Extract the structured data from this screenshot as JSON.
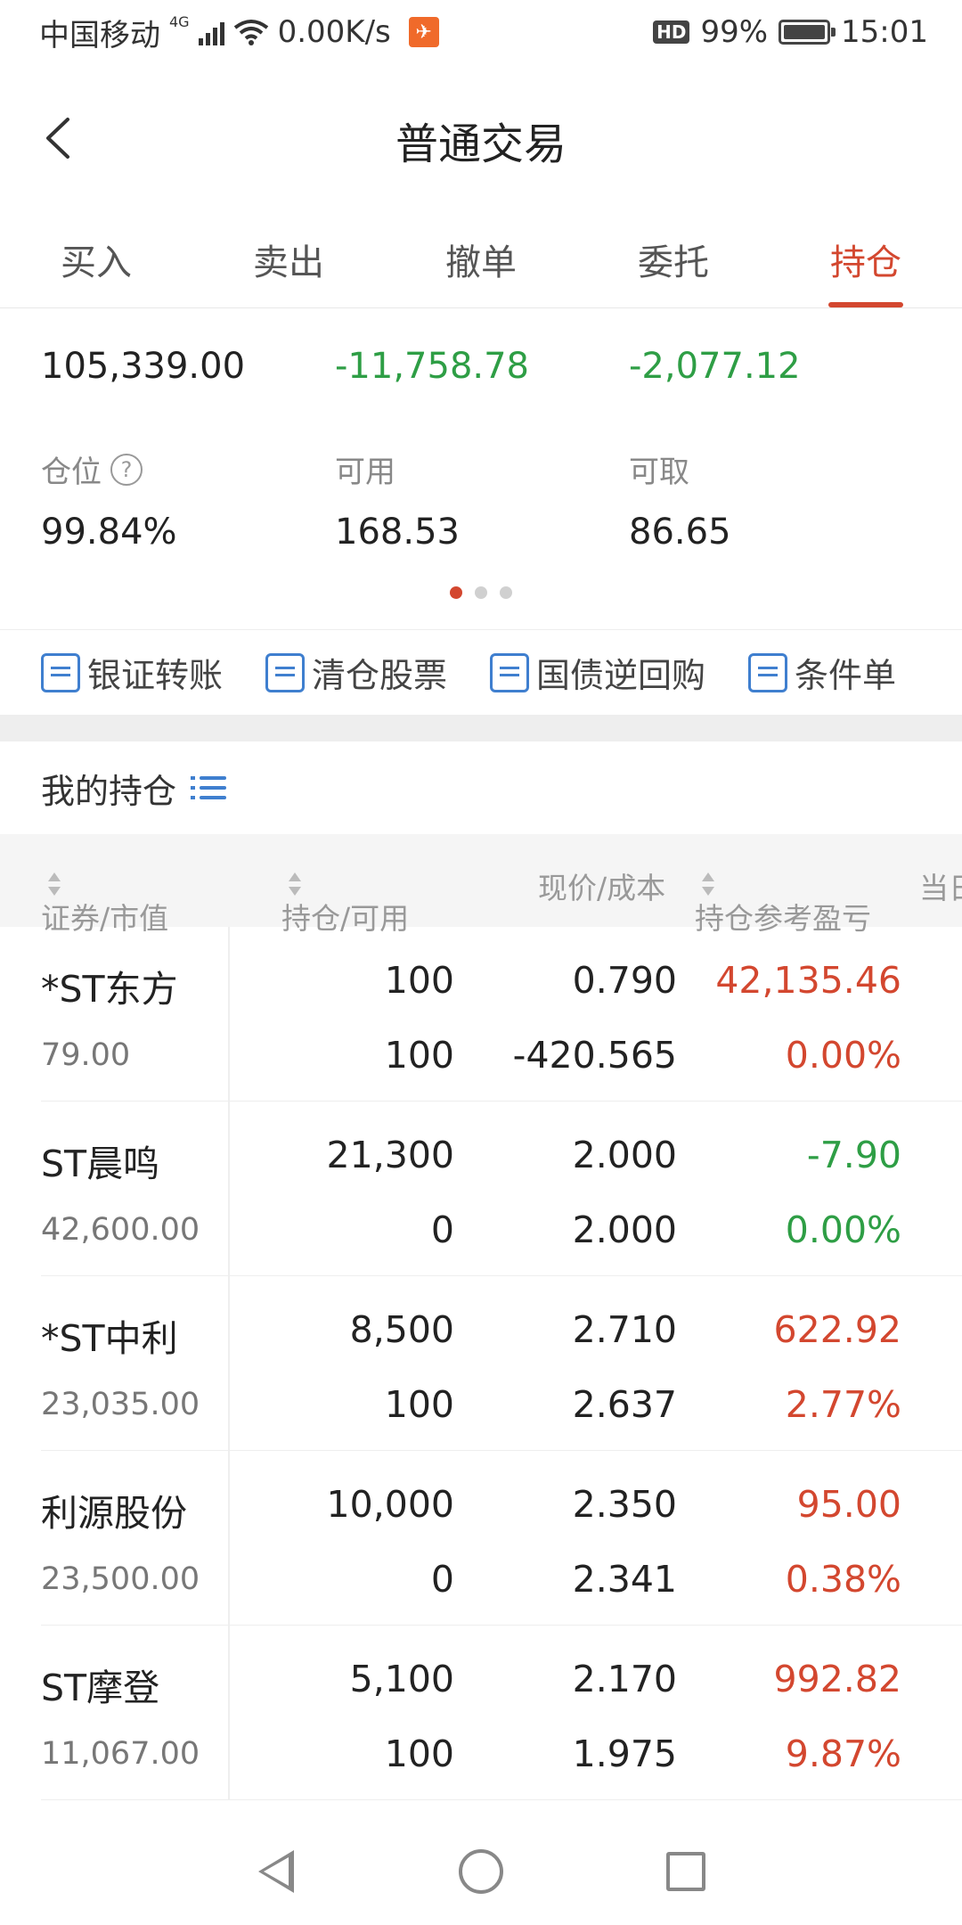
{
  "status": {
    "carrier": "中国移动",
    "network": "4G",
    "speed": "0.00K/s",
    "hd": "HD",
    "battery": "99%",
    "time": "15:01"
  },
  "title": "普通交易",
  "tabs": [
    {
      "label": "买入"
    },
    {
      "label": "卖出"
    },
    {
      "label": "撤单"
    },
    {
      "label": "委托"
    },
    {
      "label": "持仓"
    }
  ],
  "summary": {
    "row1": [
      {
        "value": "105,339.00",
        "color": "#222222"
      },
      {
        "value": "-11,758.78",
        "color": "#2e9e45"
      },
      {
        "value": "-2,077.12",
        "color": "#2e9e45"
      }
    ],
    "row2": [
      {
        "label": "仓位",
        "value": "99.84%"
      },
      {
        "label": "可用",
        "value": "168.53"
      },
      {
        "label": "可取",
        "value": "86.65"
      }
    ]
  },
  "actions": [
    {
      "label": "银证转账",
      "icon": "transfer-icon"
    },
    {
      "label": "清仓股票",
      "icon": "chart-clear-icon"
    },
    {
      "label": "国债逆回购",
      "icon": "repo-icon"
    },
    {
      "label": "条件单",
      "icon": "condition-order-icon"
    }
  ],
  "holdings_title": "我的持仓",
  "table": {
    "headers": [
      "证券/市值",
      "持仓/可用",
      "现价/成本",
      "持仓参考盈亏",
      "当日"
    ],
    "rows": [
      {
        "name": "*ST东方",
        "market_value": "79.00",
        "qty": "100",
        "avail": "100",
        "price": "0.790",
        "cost": "-420.565",
        "pnl": "42,135.46",
        "pct": "0.00%",
        "color": "red"
      },
      {
        "name": "ST晨鸣",
        "market_value": "42,600.00",
        "qty": "21,300",
        "avail": "0",
        "price": "2.000",
        "cost": "2.000",
        "pnl": "-7.90",
        "pct": "0.00%",
        "color": "green"
      },
      {
        "name": "*ST中利",
        "market_value": "23,035.00",
        "qty": "8,500",
        "avail": "100",
        "price": "2.710",
        "cost": "2.637",
        "pnl": "622.92",
        "pct": "2.77%",
        "color": "red"
      },
      {
        "name": "利源股份",
        "market_value": "23,500.00",
        "qty": "10,000",
        "avail": "0",
        "price": "2.350",
        "cost": "2.341",
        "pnl": "95.00",
        "pct": "0.38%",
        "color": "red"
      },
      {
        "name": "ST摩登",
        "market_value": "11,067.00",
        "qty": "5,100",
        "avail": "100",
        "price": "2.170",
        "cost": "1.975",
        "pnl": "992.82",
        "pct": "9.87%",
        "color": "red"
      }
    ]
  }
}
